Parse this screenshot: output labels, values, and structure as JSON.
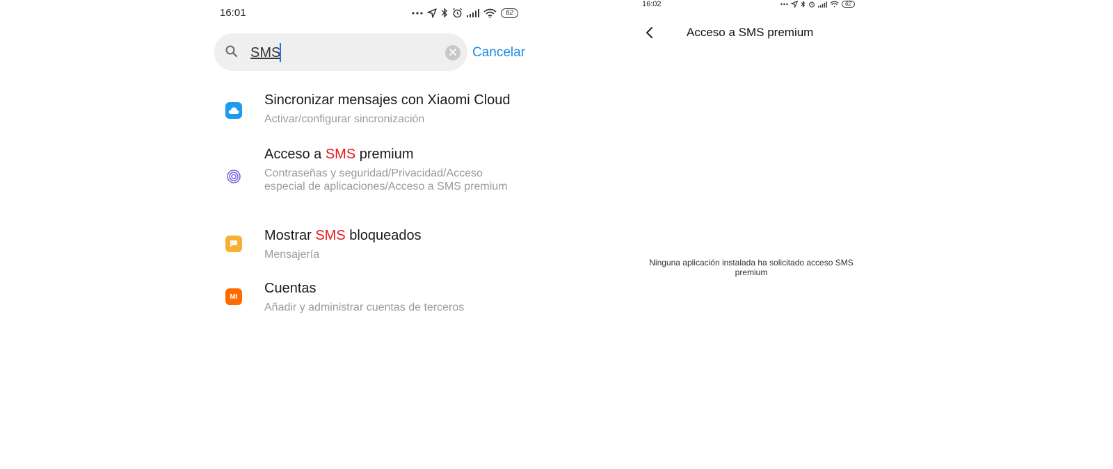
{
  "left_screen": {
    "status_bar": {
      "time": "16:01",
      "battery": "62"
    },
    "search": {
      "query": "SMS",
      "cancel_label": "Cancelar"
    },
    "results": [
      {
        "title": "Sincronizar mensajes con Xiaomi Cloud",
        "subtitle": "Activar/configurar sincronización",
        "icon": "cloud-icon",
        "color": "#1e9bf0"
      },
      {
        "title_pre": "Acceso a ",
        "title_hl": "SMS",
        "title_post": " premium",
        "subtitle": "Contraseñas y seguridad/Privacidad/Acceso especial de aplicaciones/Acceso a SMS premium",
        "icon": "fingerprint-icon",
        "color": "#7a6ee0"
      },
      {
        "title_pre": "Mostrar ",
        "title_hl": "SMS",
        "title_post": " bloqueados",
        "subtitle": "Mensajería",
        "icon": "message-icon",
        "color": "#f6b036"
      },
      {
        "title": "Cuentas",
        "subtitle": "Añadir y administrar cuentas de terceros",
        "icon": "mi-logo-icon",
        "color": "#ff6a00",
        "logo_text": "MI"
      }
    ]
  },
  "right_screen": {
    "status_bar": {
      "time": "16:02",
      "battery": "62"
    },
    "title": "Acceso a SMS premium",
    "empty_message": "Ninguna aplicación instalada ha solicitado acceso SMS premium"
  },
  "colors": {
    "accent": "#1a8ee0",
    "highlight": "#e21b1b",
    "subtitle": "#9a9a9a"
  }
}
